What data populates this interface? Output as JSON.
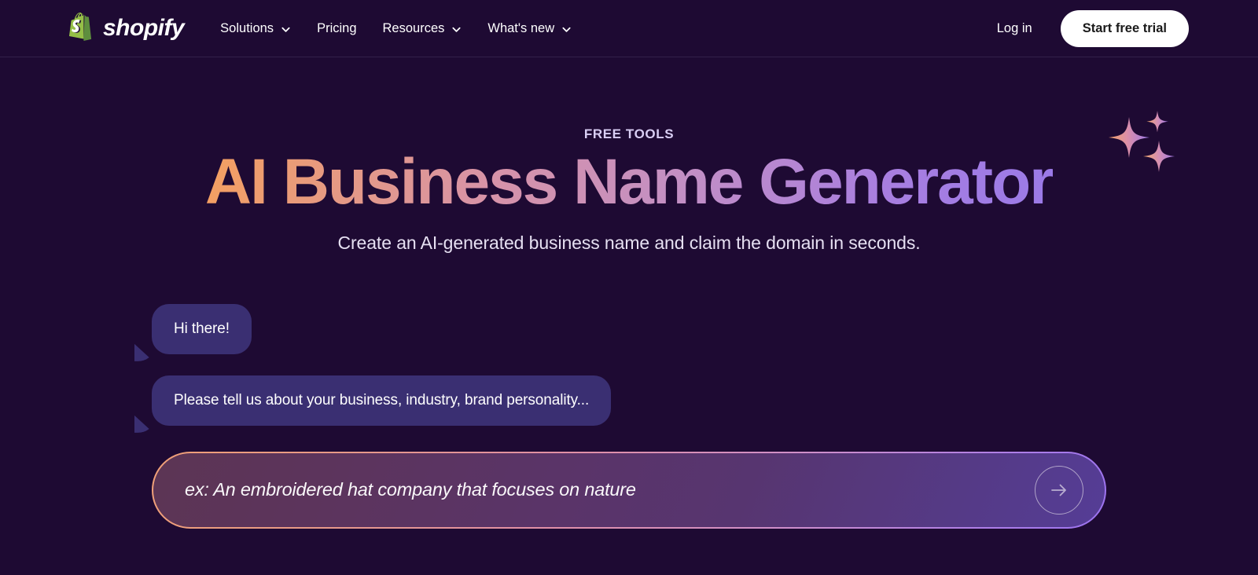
{
  "header": {
    "logo_word": "shopify",
    "logo_icon": "shopify-bag-icon",
    "nav": [
      {
        "label": "Solutions",
        "has_chevron": true
      },
      {
        "label": "Pricing",
        "has_chevron": false
      },
      {
        "label": "Resources",
        "has_chevron": true
      },
      {
        "label": "What's new",
        "has_chevron": true
      }
    ],
    "login_label": "Log in",
    "trial_label": "Start free trial"
  },
  "hero": {
    "eyebrow": "FREE TOOLS",
    "title": "AI Business Name Generator",
    "subtitle": "Create an AI-generated business name and claim the domain in seconds.",
    "sparkle_icon": "sparkles-icon"
  },
  "chat": {
    "messages": [
      {
        "text": "Hi there!"
      },
      {
        "text": "Please tell us about your business, industry, brand personality..."
      }
    ]
  },
  "prompt": {
    "value": "",
    "placeholder": "ex: An embroidered hat company that focuses on nature",
    "submit_icon": "arrow-right-icon"
  },
  "colors": {
    "page_background": "#1e0a33",
    "bubble": "#3a2f72",
    "accent_warm": "#f0a077",
    "accent_cool": "#9b72f0",
    "brand_green": "#95bf47",
    "eyebrow": "#d9cef4"
  }
}
